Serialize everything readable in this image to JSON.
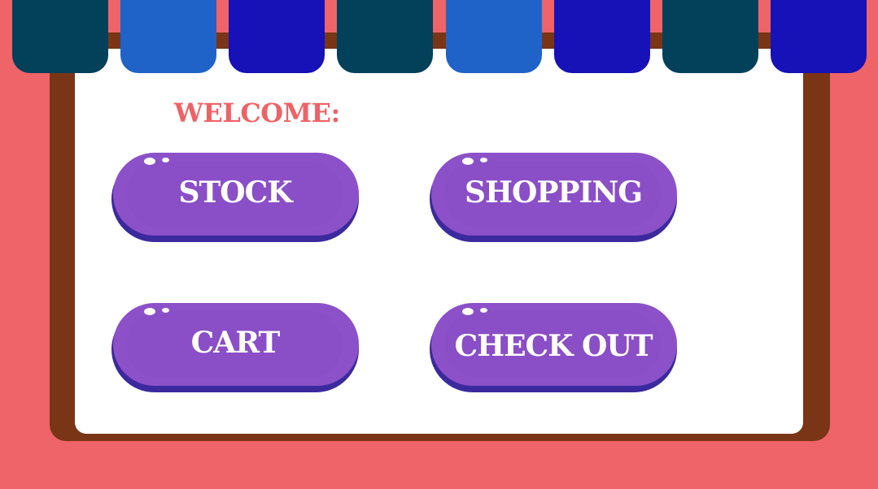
{
  "colors": {
    "background": "#ef6468",
    "frame": "#7a3516",
    "panel": "#ffffff",
    "welcome_text": "#ee6266",
    "button_face": "#8c51c8",
    "button_inner": "#8a4ec7",
    "button_base": "#3b2a9e",
    "button_text": "#ffffff",
    "awning": [
      "#03405a",
      "#1f63c9",
      "#1711b8",
      "#03405a",
      "#1f63c9",
      "#1711b8",
      "#03405a",
      "#1711b8"
    ]
  },
  "welcome": {
    "text": "WELCOME:"
  },
  "buttons": {
    "stock": "STOCK",
    "shopping": "SHOPPING",
    "cart": "CART",
    "checkout": "CHECK OUT"
  }
}
